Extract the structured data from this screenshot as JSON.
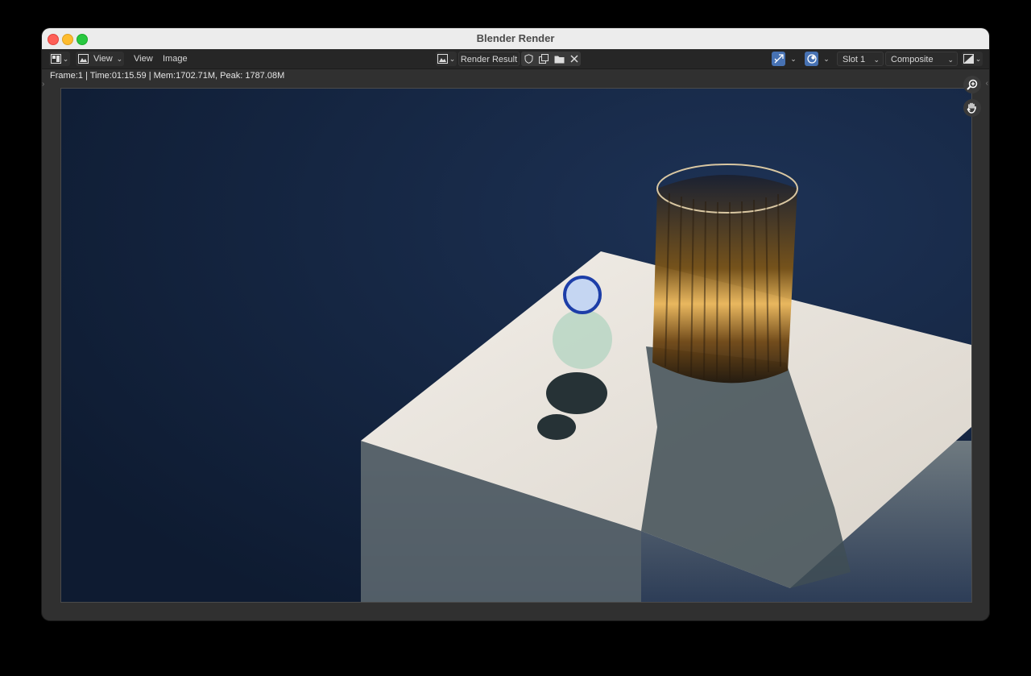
{
  "window": {
    "title": "Blender Render"
  },
  "toolbar": {
    "view_menu_label": "View",
    "view_label": "View",
    "image_label": "Image",
    "image_name": "Render Result",
    "slot": "Slot 1",
    "layer": "Composite"
  },
  "status": {
    "text": "Frame:1 | Time:01:15.59 | Mem:1702.71M, Peak: 1787.08M"
  },
  "icons": {
    "editor_type": "image-editor-icon",
    "mode": "view-mode-icon",
    "image_browse": "image-browse-icon",
    "fake_user": "shield-icon",
    "new_image": "duplicate-icon",
    "open_image": "folder-icon",
    "unlink": "close-icon",
    "gizmo_toggle": "gizmo-icon",
    "overlay_toggle": "overlay-icon",
    "display_channels": "channels-icon",
    "zoom": "zoom-in-icon",
    "pan": "hand-icon"
  },
  "colors": {
    "accent": "#4772b3",
    "header_bg": "#262626",
    "area_bg": "#303030",
    "render_bg": "#16263f"
  }
}
